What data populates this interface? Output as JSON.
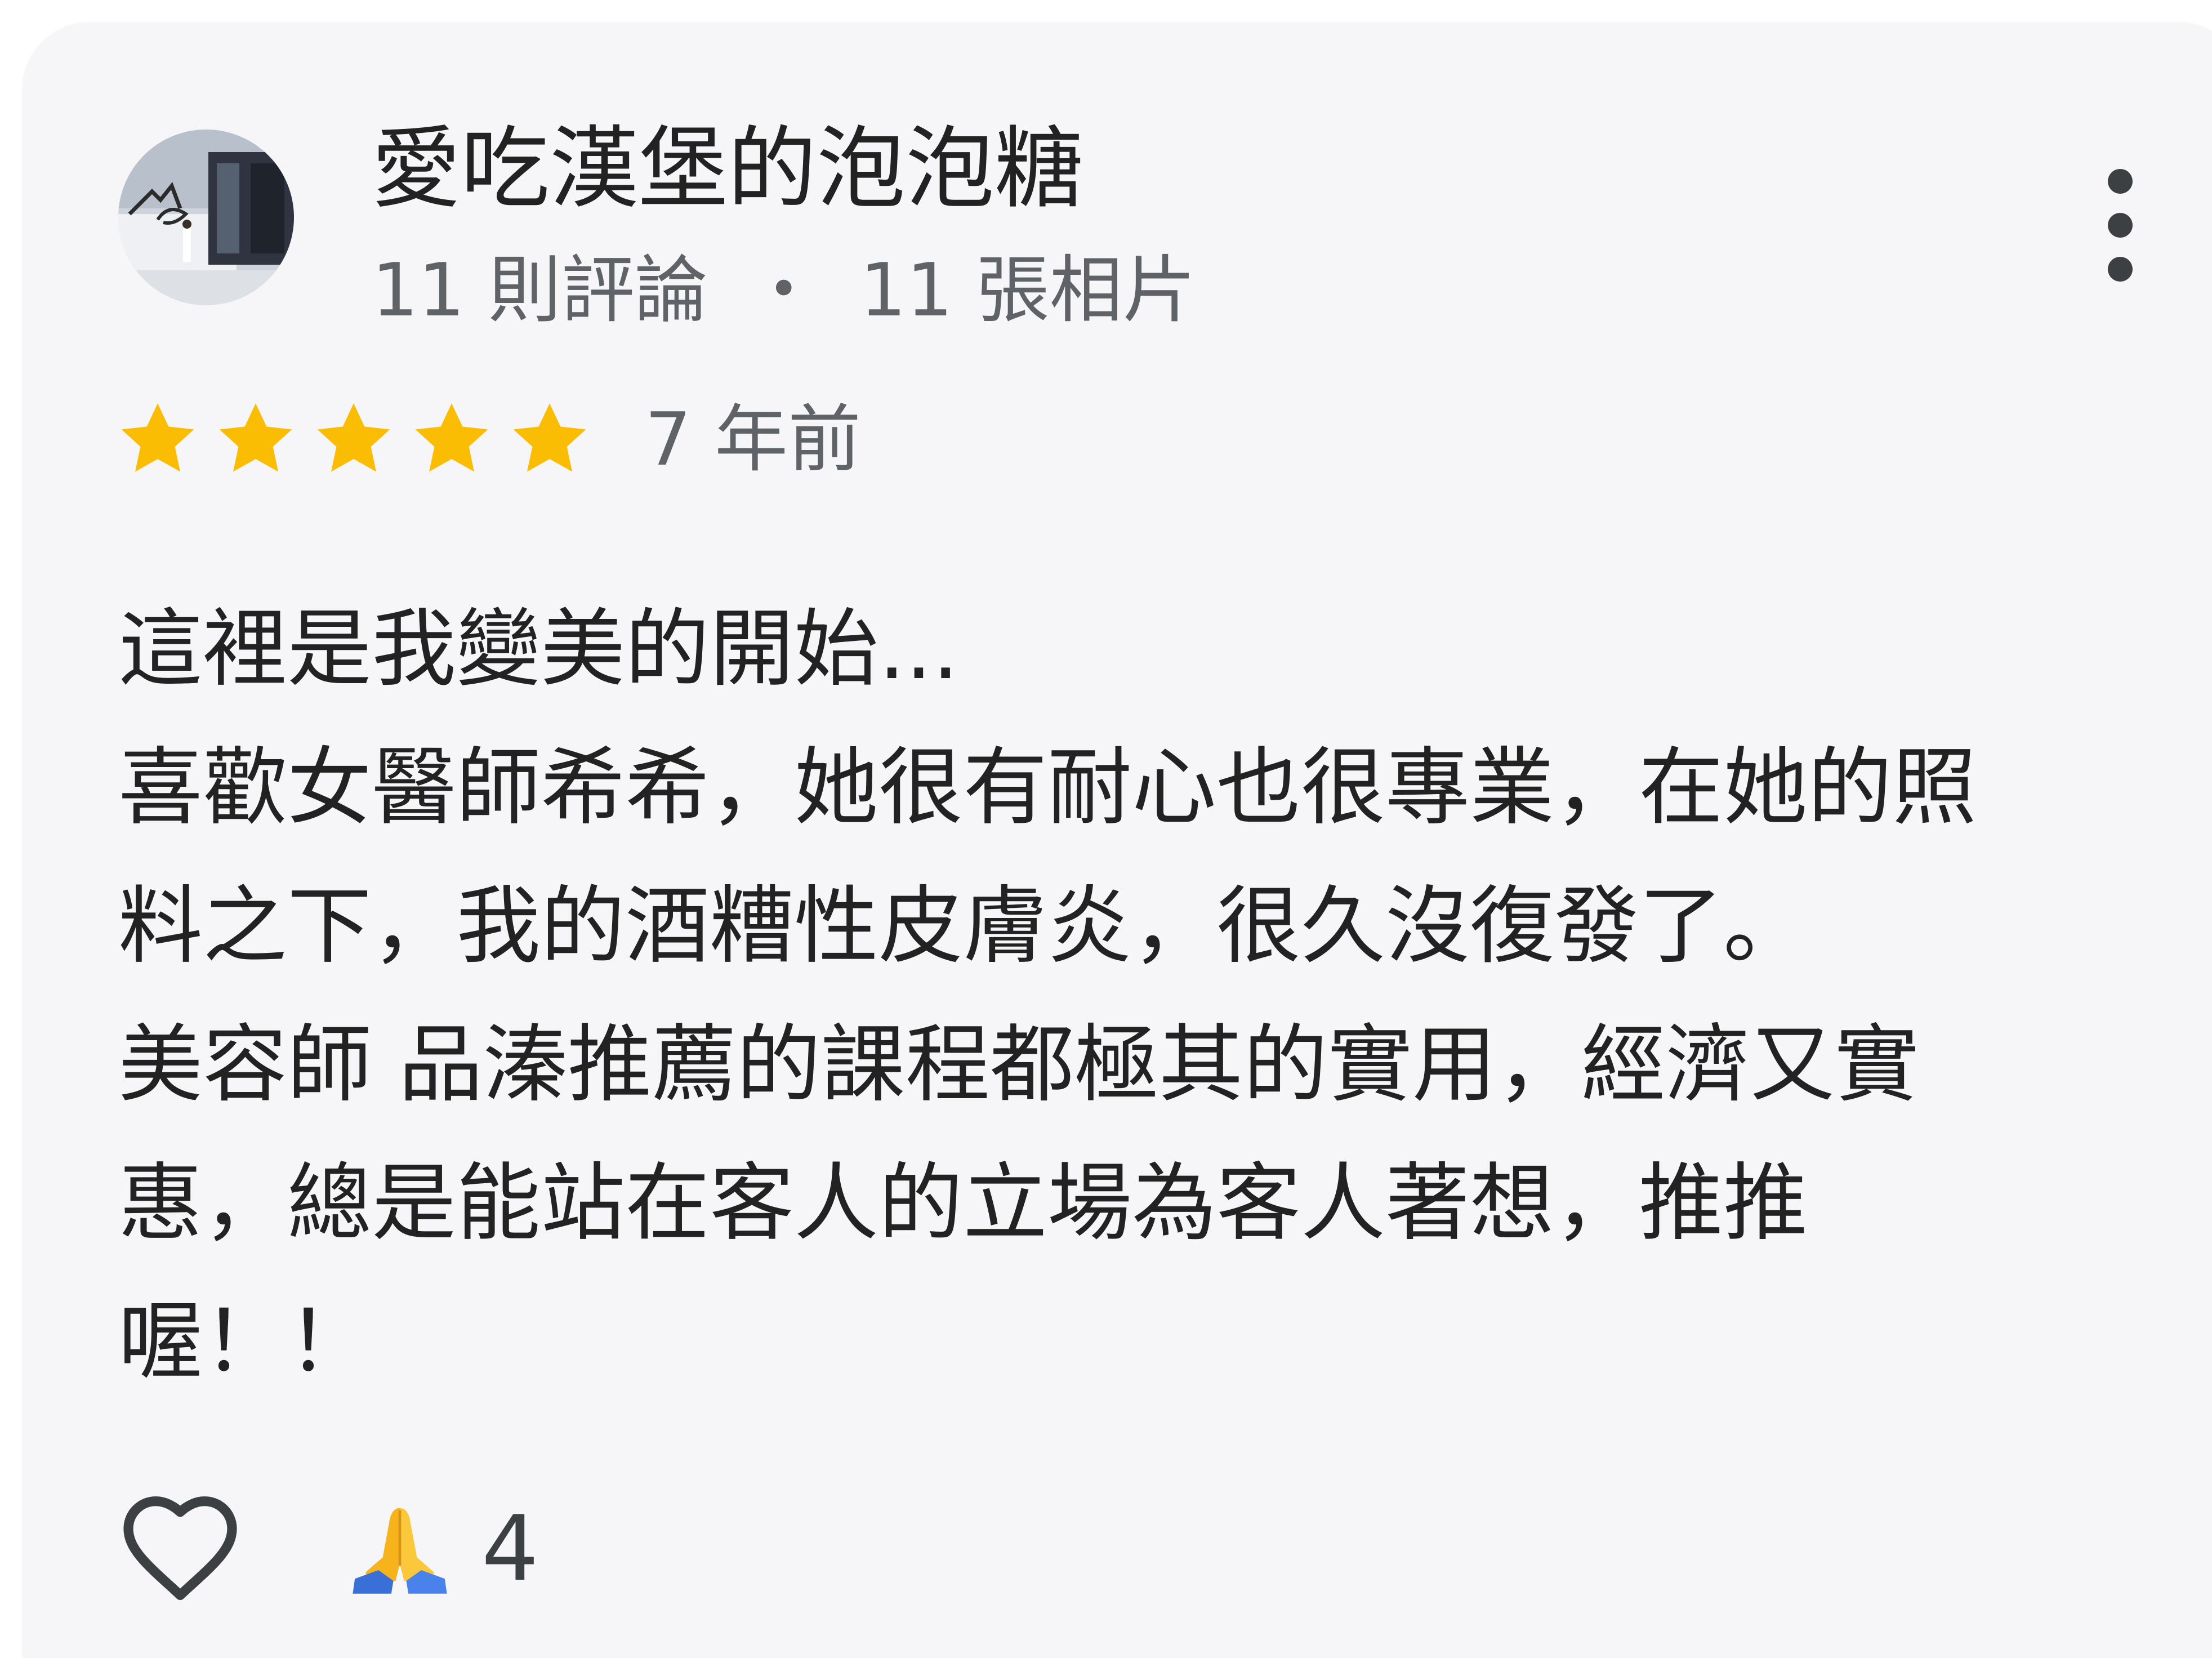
{
  "reviewer": {
    "name": "愛吃漢堡的泡泡糖",
    "reviews_count": "11 則評論",
    "separator": "・",
    "photos_count": "11 張相片"
  },
  "rating": {
    "stars": 5,
    "max": 5,
    "time": "7 年前"
  },
  "review": {
    "lines": [
      "這裡是我變美的開始...",
      "喜歡女醫師希希，她很有耐心也很專業，在她的照",
      "料之下，我的酒糟性皮膚炎，很久沒復發了。",
      "美容師 品溱推薦的課程都極其的實用，經濟又實",
      "惠，總是能站在客人的立場為客人著想，推推",
      "喔！！"
    ]
  },
  "actions": {
    "like_icon": "heart-outline-icon",
    "reaction_icon": "folded-hands-emoji",
    "reaction_count": "4"
  },
  "colors": {
    "card_background": "#f6f6f8",
    "star": "#fbbc04",
    "text_primary": "#222222",
    "text_secondary": "#5f6368"
  }
}
